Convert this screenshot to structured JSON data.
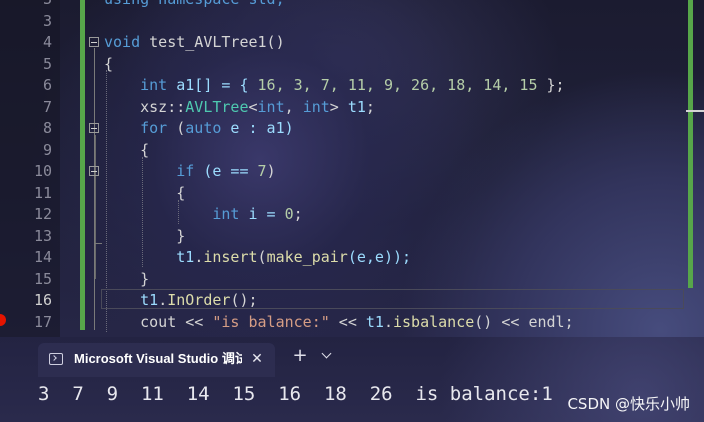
{
  "editor": {
    "lines": [
      {
        "num": "3",
        "code": [
          {
            "t": "using namespace std;",
            "c": "kw"
          }
        ]
      },
      {
        "num": "3",
        "code": []
      },
      {
        "num": "4",
        "code": [
          {
            "t": "void",
            "c": "kw"
          },
          {
            "t": " test_AVLTree1()",
            "c": "pl"
          }
        ]
      },
      {
        "num": "5",
        "code": [
          {
            "t": "{",
            "c": "pl"
          }
        ]
      },
      {
        "num": "6",
        "code": [
          {
            "t": "    int",
            "c": "kw"
          },
          {
            "t": " a1[] = { ",
            "c": "var"
          },
          {
            "t": "16, 3, 7, 11, 9, 26, 18, 14, 15",
            "c": "num"
          },
          {
            "t": " };",
            "c": "pl"
          }
        ]
      },
      {
        "num": "7",
        "code": [
          {
            "t": "    xsz",
            "c": "ns"
          },
          {
            "t": "::",
            "c": "pl"
          },
          {
            "t": "AVLTree",
            "c": "ty"
          },
          {
            "t": "<",
            "c": "pl"
          },
          {
            "t": "int",
            "c": "kw"
          },
          {
            "t": ", ",
            "c": "pl"
          },
          {
            "t": "int",
            "c": "kw"
          },
          {
            "t": "> ",
            "c": "pl"
          },
          {
            "t": "t1",
            "c": "var"
          },
          {
            "t": ";",
            "c": "pl"
          }
        ]
      },
      {
        "num": "8",
        "code": [
          {
            "t": "    for",
            "c": "kw"
          },
          {
            "t": " (",
            "c": "pl"
          },
          {
            "t": "auto",
            "c": "kw"
          },
          {
            "t": " e : a1)",
            "c": "var"
          }
        ]
      },
      {
        "num": "9",
        "code": [
          {
            "t": "    {",
            "c": "pl"
          }
        ]
      },
      {
        "num": "10",
        "code": [
          {
            "t": "        if",
            "c": "kw"
          },
          {
            "t": " (e == ",
            "c": "var"
          },
          {
            "t": "7",
            "c": "num"
          },
          {
            "t": ")",
            "c": "pl"
          }
        ]
      },
      {
        "num": "11",
        "code": [
          {
            "t": "        {",
            "c": "pl"
          }
        ]
      },
      {
        "num": "12",
        "code": [
          {
            "t": "            int",
            "c": "kw"
          },
          {
            "t": " i = ",
            "c": "var"
          },
          {
            "t": "0",
            "c": "num"
          },
          {
            "t": ";",
            "c": "pl"
          }
        ]
      },
      {
        "num": "13",
        "code": [
          {
            "t": "        }",
            "c": "pl"
          }
        ]
      },
      {
        "num": "14",
        "code": [
          {
            "t": "        t1",
            "c": "var"
          },
          {
            "t": ".",
            "c": "pl"
          },
          {
            "t": "insert",
            "c": "fn"
          },
          {
            "t": "(",
            "c": "pl"
          },
          {
            "t": "make_pair",
            "c": "fn"
          },
          {
            "t": "(e,e));",
            "c": "var"
          }
        ]
      },
      {
        "num": "15",
        "code": [
          {
            "t": "    }",
            "c": "pl"
          }
        ]
      },
      {
        "num": "16",
        "code": [
          {
            "t": "    t1",
            "c": "var"
          },
          {
            "t": ".",
            "c": "pl"
          },
          {
            "t": "InOrder",
            "c": "fn"
          },
          {
            "t": "();",
            "c": "pl"
          }
        ]
      },
      {
        "num": "17",
        "code": [
          {
            "t": "    cout << ",
            "c": "pl"
          },
          {
            "t": "\"is balance:\"",
            "c": "str"
          },
          {
            "t": " << ",
            "c": "pl"
          },
          {
            "t": "t1",
            "c": "var"
          },
          {
            "t": ".",
            "c": "pl"
          },
          {
            "t": "isbalance",
            "c": "fn"
          },
          {
            "t": "() << endl;",
            "c": "pl"
          }
        ]
      }
    ],
    "active_line": "16"
  },
  "terminal": {
    "tab_title": "Microsoft Visual Studio 调试控制台",
    "tab_close": "✕",
    "new_tab": "+",
    "output": "3  7  9  11  14  15  16  18  26  is balance:1"
  },
  "watermark": "CSDN @快乐小帅"
}
